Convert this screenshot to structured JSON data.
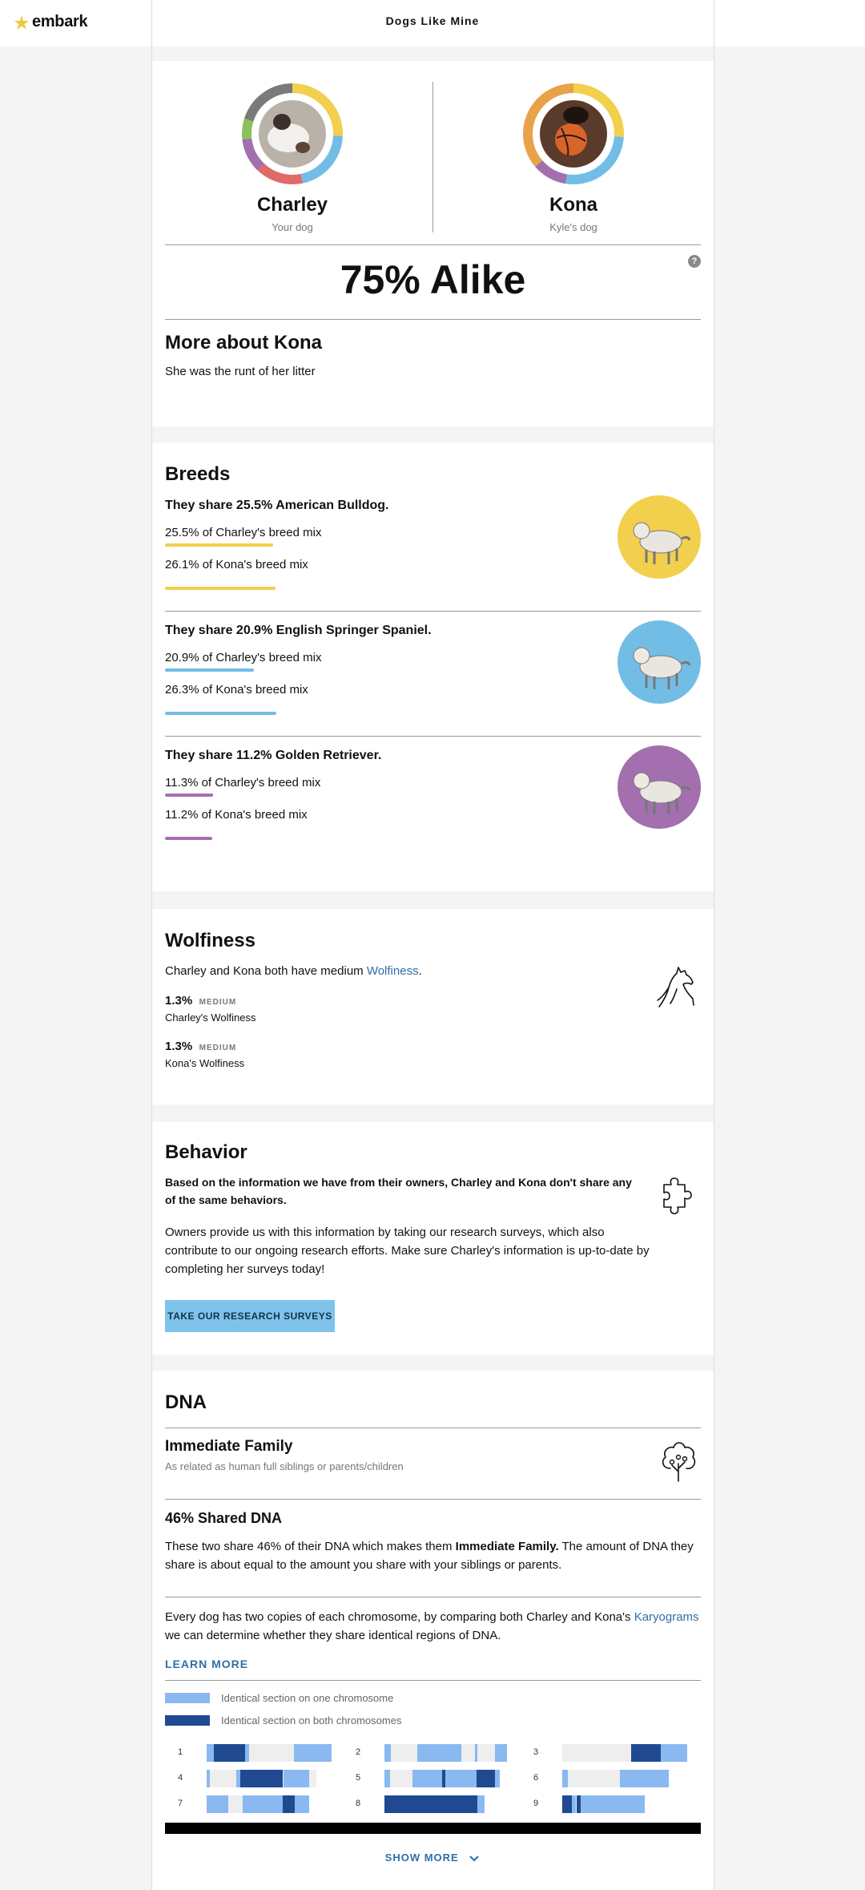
{
  "header": {
    "brand": "embark",
    "title": "Dogs Like Mine"
  },
  "dogs": [
    {
      "name": "Charley",
      "sub": "Your dog"
    },
    {
      "name": "Kona",
      "sub": "Kyle's dog"
    }
  ],
  "similarity": {
    "value": "75% Alike",
    "help_icon": "?"
  },
  "about": {
    "title": "More about Kona",
    "text": "She was the runt of her litter"
  },
  "breeds": {
    "title": "Breeds",
    "items": [
      {
        "title": "They share 25.5% American Bulldog.",
        "line1": "25.5% of Charley's breed mix",
        "line2": "26.1% of Kona's breed mix",
        "v1": 25.5,
        "v2": 26.1,
        "color": "#f2cf4d",
        "icon": "bulldog-icon"
      },
      {
        "title": "They share 20.9% English Springer Spaniel.",
        "line1": "20.9% of Charley's breed mix",
        "line2": "26.3% of Kona's breed mix",
        "v1": 20.9,
        "v2": 26.3,
        "color": "#72bde6",
        "icon": "springer-spaniel-icon"
      },
      {
        "title": "They share 11.2% Golden Retriever.",
        "line1": "11.3% of Charley's breed mix",
        "line2": "11.2% of Kona's breed mix",
        "v1": 11.3,
        "v2": 11.2,
        "color": "#a36fae",
        "icon": "golden-retriever-icon"
      }
    ]
  },
  "wolfiness": {
    "title": "Wolfiness",
    "text_before": "Charley and Kona both have medium ",
    "link": "Wolfiness",
    "text_after": ".",
    "entries": [
      {
        "value": "1.3%",
        "level": "MEDIUM",
        "label": "Charley's Wolfiness"
      },
      {
        "value": "1.3%",
        "level": "MEDIUM",
        "label": "Kona's Wolfiness"
      }
    ]
  },
  "behavior": {
    "title": "Behavior",
    "bold_text": "Based on the information we have from their owners, Charley and Kona don't share any of the same behaviors.",
    "text": "Owners provide us with this information by taking our research surveys, which also contribute to our ongoing research efforts. Make sure Charley's information is up-to-date by completing her surveys today!",
    "button": "TAKE OUR RESEARCH SURVEYS"
  },
  "dna": {
    "title": "DNA",
    "family_title": "Immediate Family",
    "family_sub": "As related as human full siblings or parents/children",
    "shared_title": "46% Shared DNA",
    "shared_text_1": "These two share 46% of their DNA which makes them ",
    "shared_bold": "Immediate Family.",
    "shared_text_2": " The amount of DNA they share is about equal to the amount you share with your siblings or parents.",
    "karyo_text_1": "Every dog has two copies of each chromosome, by comparing both Charley and Kona's ",
    "karyo_link": "Karyograms",
    "karyo_text_2": " we can determine whether they share identical regions of DNA.",
    "learn_more": "LEARN MORE",
    "legend": [
      {
        "label": "Identical section on one chromosome",
        "color": "#8ab8f0"
      },
      {
        "label": "Identical section on both chromosomes",
        "color": "#1f4a92"
      }
    ],
    "chromosomes": [
      {
        "n": "1",
        "len": 1.0,
        "segs": [
          [
            0.0,
            0.06,
            1
          ],
          [
            0.06,
            0.31,
            2
          ],
          [
            0.31,
            0.34,
            1
          ],
          [
            0.7,
            1.0,
            1
          ]
        ]
      },
      {
        "n": "2",
        "len": 0.98,
        "segs": [
          [
            0.0,
            0.05,
            1
          ],
          [
            0.27,
            0.63,
            1
          ],
          [
            0.74,
            0.76,
            1
          ],
          [
            0.9,
            1.0,
            1
          ]
        ]
      },
      {
        "n": "3",
        "len": 1.0,
        "segs": [
          [
            0.55,
            0.79,
            2
          ],
          [
            0.79,
            1.0,
            1
          ]
        ]
      },
      {
        "n": "4",
        "len": 0.88,
        "segs": [
          [
            0.0,
            0.03,
            1
          ],
          [
            0.27,
            0.31,
            1
          ],
          [
            0.31,
            0.7,
            2
          ],
          [
            0.7,
            0.93,
            1
          ]
        ]
      },
      {
        "n": "5",
        "len": 0.92,
        "segs": [
          [
            0.0,
            0.05,
            1
          ],
          [
            0.24,
            0.39,
            1
          ],
          [
            0.39,
            0.5,
            1
          ],
          [
            0.5,
            0.53,
            2
          ],
          [
            0.53,
            0.8,
            1
          ],
          [
            0.8,
            0.96,
            2
          ],
          [
            0.96,
            1.0,
            1
          ]
        ]
      },
      {
        "n": "6",
        "len": 0.85,
        "segs": [
          [
            0.0,
            0.05,
            1
          ],
          [
            0.54,
            1.0,
            1
          ]
        ]
      },
      {
        "n": "7",
        "len": 0.82,
        "segs": [
          [
            0.0,
            0.21,
            1
          ],
          [
            0.35,
            0.74,
            1
          ],
          [
            0.74,
            0.86,
            2
          ],
          [
            0.86,
            1.0,
            1
          ]
        ]
      },
      {
        "n": "8",
        "len": 0.8,
        "segs": [
          [
            0.0,
            0.93,
            2
          ],
          [
            0.93,
            1.0,
            1
          ]
        ]
      },
      {
        "n": "9",
        "len": 0.66,
        "segs": [
          [
            0.0,
            0.12,
            2
          ],
          [
            0.12,
            0.17,
            1
          ],
          [
            0.17,
            0.22,
            2
          ],
          [
            0.22,
            1.0,
            1
          ]
        ]
      }
    ],
    "show_more": "SHOW MORE"
  }
}
